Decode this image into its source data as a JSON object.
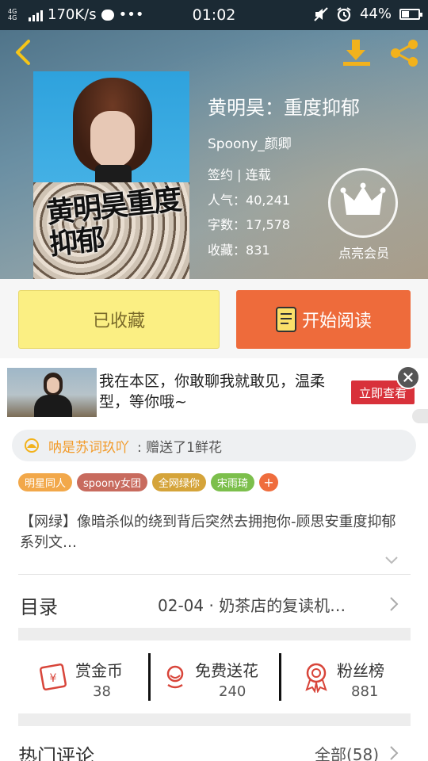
{
  "status_bar": {
    "network": "4G 4G",
    "speed": "170K/s",
    "dots": "•••",
    "time": "01:02",
    "battery": "44%",
    "battery_level": 0.44
  },
  "book": {
    "title": "黄明昊：重度抑郁",
    "author": "Spoony_颜卿",
    "status": "签约 | 连载",
    "popularity_label": "人气：",
    "popularity": "40,241",
    "wordcount_label": "字数：",
    "wordcount": "17,578",
    "favorites_label": "收藏：",
    "favorites": "831",
    "cover_art_text": "黄明昊重度抑郁"
  },
  "vip": {
    "label": "点亮会员"
  },
  "actions": {
    "favorited_label": "已收藏",
    "read_label": "开始阅读"
  },
  "ad": {
    "text": "我在本区，你敢聊我就敢见，温柔型，等你哦~",
    "cta": "立即查看"
  },
  "gift": {
    "user": "呐是苏词玖吖",
    "action": ": 赠送了1鲜花"
  },
  "tags": [
    {
      "label": "明星同人",
      "color": "#f2a84a"
    },
    {
      "label": "spoony女团",
      "color": "#c86b5e"
    },
    {
      "label": "全网绿你",
      "color": "#d5a43a"
    },
    {
      "label": "宋雨琦",
      "color": "#7cbf4c"
    }
  ],
  "tag_add": "+",
  "description": "【网绿】像暗杀似的绕到背后突然去拥抱你-顾思安重度抑郁系列文…",
  "toc": {
    "label": "目录",
    "latest": "02-04 · 奶茶店的复读机…"
  },
  "stats": {
    "reward": {
      "label": "赏金币",
      "value": "38"
    },
    "flowers": {
      "label": "免费送花",
      "value": "240"
    },
    "fans": {
      "label": "粉丝榜",
      "value": "881"
    }
  },
  "comments": {
    "title": "热门评论",
    "all": "全部(58)"
  },
  "colors": {
    "accent_orange": "#ee6b3b",
    "fav_yellow": "#fbef83",
    "icon_gold": "#f2b21c",
    "icon_red": "#d8453a"
  }
}
